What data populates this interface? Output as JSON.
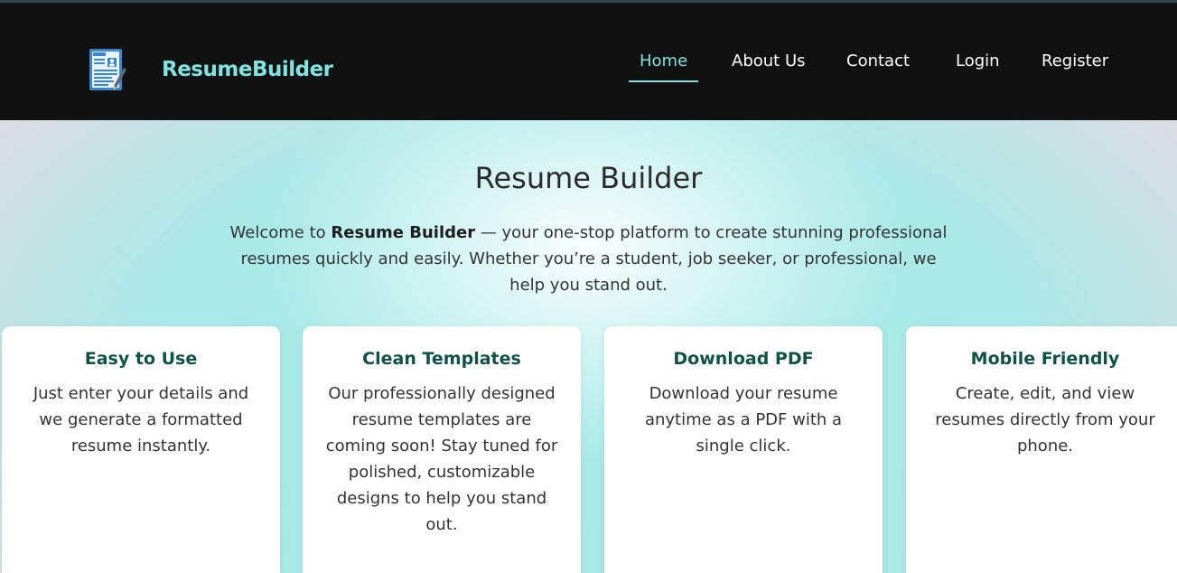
{
  "brand": {
    "name": "ResumeBuilder",
    "color": "#7fe3df",
    "icon": "resume-document-icon"
  },
  "nav": {
    "items": [
      {
        "label": "Home",
        "active": true
      },
      {
        "label": "About Us",
        "active": false
      },
      {
        "label": "Contact",
        "active": false
      },
      {
        "label": "Login",
        "active": false
      },
      {
        "label": "Register",
        "active": false
      }
    ],
    "active_color": "#7fe3df"
  },
  "hero": {
    "title": "Resume Builder",
    "desc_prefix": "Welcome to ",
    "desc_bold": "Resume Builder",
    "desc_suffix": " — your one-stop platform to create stunning professional resumes quickly and easily. Whether you’re a student, job seeker, or professional, we help you stand out."
  },
  "features": [
    {
      "title": "Easy to Use",
      "text": "Just enter your details and we generate a formatted resume instantly."
    },
    {
      "title": "Clean Templates",
      "text": "Our professionally designed resume templates are coming soon! Stay tuned for polished, customizable designs to help you stand out."
    },
    {
      "title": "Download PDF",
      "text": "Download your resume anytime as a PDF with a single click."
    },
    {
      "title": "Mobile Friendly",
      "text": "Create, edit, and view resumes directly from your phone."
    }
  ],
  "colors": {
    "navbar_bg": "#111111",
    "card_title": "#0f5248",
    "hero_accent": "#a9e9e6"
  }
}
